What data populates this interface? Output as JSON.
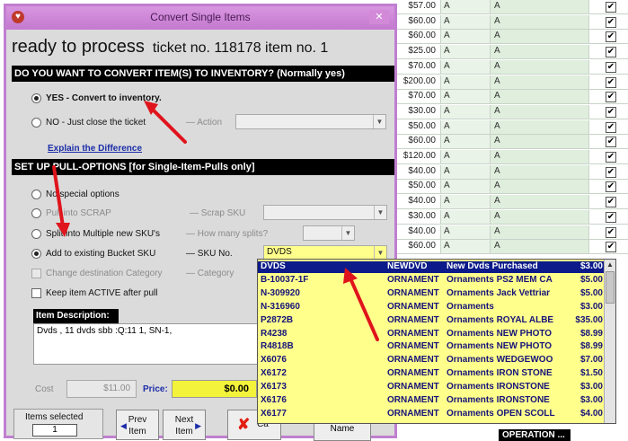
{
  "background_grid": {
    "rows": [
      {
        "price": "$57.00",
        "a": "A",
        "b": "A",
        "checked": true
      },
      {
        "price": "$60.00",
        "a": "A",
        "b": "A",
        "checked": true
      },
      {
        "price": "$60.00",
        "a": "A",
        "b": "A",
        "checked": true
      },
      {
        "price": "$25.00",
        "a": "A",
        "b": "A",
        "checked": true
      },
      {
        "price": "$70.00",
        "a": "A",
        "b": "A",
        "checked": true
      },
      {
        "price": "$200.00",
        "a": "A",
        "b": "A",
        "checked": true
      },
      {
        "price": "$70.00",
        "a": "A",
        "b": "A",
        "checked": true
      },
      {
        "price": "$30.00",
        "a": "A",
        "b": "A",
        "checked": true
      },
      {
        "price": "$50.00",
        "a": "A",
        "b": "A",
        "checked": true
      },
      {
        "price": "$60.00",
        "a": "A",
        "b": "A",
        "checked": true
      },
      {
        "price": "$120.00",
        "a": "A",
        "b": "A",
        "checked": true
      },
      {
        "price": "$40.00",
        "a": "A",
        "b": "A",
        "checked": true
      },
      {
        "price": "$50.00",
        "a": "A",
        "b": "A",
        "checked": true
      },
      {
        "price": "$40.00",
        "a": "A",
        "b": "A",
        "checked": true
      },
      {
        "price": "$30.00",
        "a": "A",
        "b": "A",
        "checked": true
      },
      {
        "price": "$40.00",
        "a": "A",
        "b": "A",
        "checked": true
      },
      {
        "price": "$60.00",
        "a": "A",
        "b": "A",
        "checked": true
      }
    ],
    "operation_label": "OPERATION ..."
  },
  "dialog": {
    "title": "Convert Single Items",
    "close_glyph": "✕",
    "heading": "ready to process",
    "ticket_info": "ticket no. 118178 item no. 1",
    "section1_header": "DO YOU WANT TO CONVERT ITEM(S)  TO INVENTORY? (Normally yes)",
    "opt_yes": "YES - Convert to inventory.",
    "opt_no": "NO - Just close the ticket",
    "action_label": "Action",
    "explain_link": "Explain the Difference",
    "section2_header": "SET UP PULL-OPTIONS  [for Single-Item-Pulls only]",
    "opt_no_special": "No special options",
    "opt_scrap": "Pull into SCRAP",
    "scrap_label": "Scrap SKU",
    "opt_multiple": "Split into Multiple new SKU's",
    "how_many_label": "How many splits?",
    "opt_bucket": "Add to existing Bucket SKU",
    "sku_label": "SKU No.",
    "sku_value": "DVDS",
    "opt_change_cat": "Change destination Category",
    "category_label": "Category",
    "opt_keep_active": "Keep item ACTIVE after pull",
    "desc_header": "Item Description:",
    "desc_text": "Dvds , 11 dvds sbb :Q:11 1, SN-1,",
    "cost_label": "Cost",
    "cost_value": "$11.00",
    "price_label": "Price:",
    "price_value": "$0.00",
    "items_selected_label": "Items selected",
    "items_selected_value": "1",
    "prev_btn": [
      "Prev",
      "Item"
    ],
    "next_btn": [
      "Next",
      "Item"
    ],
    "cancel_btn": "Ca",
    "rename_btn": "Name"
  },
  "dropdown": {
    "rows": [
      {
        "sku": "DVDS",
        "cat": "NEWDVD",
        "desc": "New Dvds Purchased",
        "price": "$3.00",
        "selected": true
      },
      {
        "sku": "B-10037-1F",
        "cat": "ORNAMENT",
        "desc": "Ornaments PS2 MEM CA",
        "price": "$5.00"
      },
      {
        "sku": "N-309920",
        "cat": "ORNAMENT",
        "desc": "Ornaments Jack Vettriar",
        "price": "$5.00"
      },
      {
        "sku": "N-316960",
        "cat": "ORNAMENT",
        "desc": "Ornaments",
        "price": "$3.00"
      },
      {
        "sku": "P2872B",
        "cat": "ORNAMENT",
        "desc": "Ornaments ROYAL ALBE",
        "price": "$35.00"
      },
      {
        "sku": "R4238",
        "cat": "ORNAMENT",
        "desc": "Ornaments NEW PHOTO",
        "price": "$8.99"
      },
      {
        "sku": "R4818B",
        "cat": "ORNAMENT",
        "desc": "Ornaments NEW PHOTO",
        "price": "$8.99"
      },
      {
        "sku": "X6076",
        "cat": "ORNAMENT",
        "desc": "Ornaments WEDGEWOO",
        "price": "$7.00"
      },
      {
        "sku": "X6172",
        "cat": "ORNAMENT",
        "desc": "Ornaments IRON STONE",
        "price": "$1.50"
      },
      {
        "sku": "X6173",
        "cat": "ORNAMENT",
        "desc": "Ornaments IRONSTONE",
        "price": "$3.00"
      },
      {
        "sku": "X6176",
        "cat": "ORNAMENT",
        "desc": "Ornaments IRONSTONE",
        "price": "$3.00"
      },
      {
        "sku": "X6177",
        "cat": "ORNAMENT",
        "desc": "Ornaments OPEN SCOLL",
        "price": "$4.00"
      }
    ]
  },
  "colors": {
    "title_bar": "#c479cf",
    "selection": "#0c1a8a",
    "dropdown_bg": "#ffff8c",
    "price_field": "#f3f33b",
    "annotation_arrow": "#e0141c",
    "link": "#1b2da8"
  }
}
